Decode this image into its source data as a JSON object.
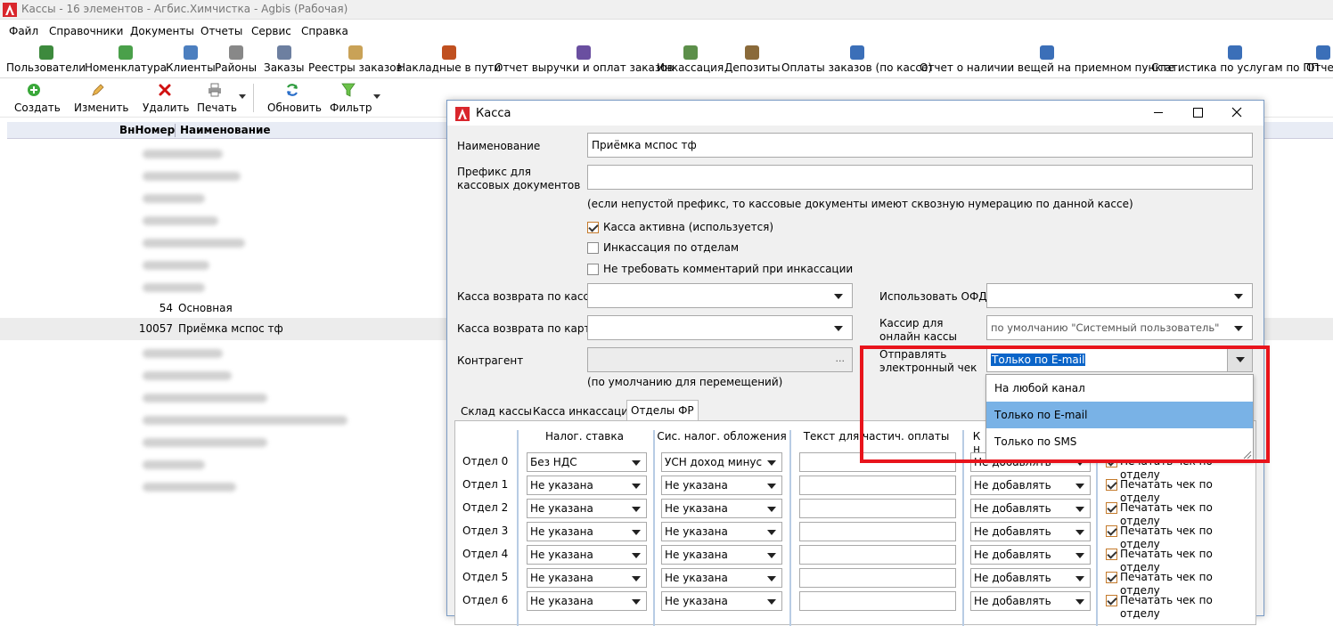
{
  "app": {
    "title": "Кассы - 16 элементов - Агбис.Химчистка - Agbis (Рабочая)"
  },
  "menu": [
    "Файл",
    "Справочники",
    "Документы",
    "Отчеты",
    "Сервис",
    "Справка"
  ],
  "ribbon": [
    "Пользователи",
    "Номенклатура",
    "Клиенты",
    "Районы",
    "Заказы",
    "Реестры заказов",
    "Накладные в пути",
    "Отчет выручки и оплат заказов",
    "Инкассация",
    "Депозиты",
    "Оплаты заказов (по кассе)",
    "Отчет о наличии вещей на приемном пункте",
    "Статистика по услугам по ПП",
    "Отчет"
  ],
  "toolbar": {
    "create": "Создать",
    "edit": "Изменить",
    "delete": "Удалить",
    "print": "Печать",
    "refresh": "Обновить",
    "filter": "Фильтр"
  },
  "grid": {
    "col_num": "ВнНомер",
    "col_name": "Наименование",
    "rows": [
      {
        "num": "54",
        "name": "Основная"
      },
      {
        "num": "10057",
        "name": "Приёмка мспос тф"
      }
    ]
  },
  "dialog": {
    "title": "Касса",
    "name_label": "Наименование",
    "name_value": "Приёмка мспос тф",
    "prefix_label": "Префикс для кассовых документов",
    "prefix_value": "",
    "prefix_hint": "(если непустой префикс, то кассовые документы имеют сквозную нумерацию по данной кассе)",
    "cb_active": "Касса активна (используется)",
    "cb_dept": "Инкассация по отделам",
    "cb_nocomment": "Не требовать комментарий при инкассации",
    "return_cash_label": "Касса возврата по кассе",
    "return_card_label": "Касса возврата по карте",
    "counterparty_label": "Контрагент",
    "counterparty_btn": "...",
    "counterparty_hint": "(по умолчанию для перемещений)",
    "ofd_label": "Использовать ОФД",
    "cashier_label": "Кассир для онлайн кассы",
    "cashier_value": "по умолчанию \"Системный пользователь\"",
    "send_label": "Отправлять электронный чек",
    "send_value": "Только по E-mail",
    "send_options": [
      "На любой канал",
      "Только по E-mail",
      "Только по SMS"
    ],
    "tabs": [
      "Склад кассы",
      "Касса инкассации",
      "Отделы ФР"
    ],
    "columns": {
      "tax": "Налог. ставка",
      "system": "Сис. налог. обложения",
      "text": "Текст для частич. оплаты",
      "k": "К н"
    },
    "departments": [
      {
        "label": "Отдел 0",
        "tax": "Без НДС",
        "system": "УСН доход минус расход",
        "add": "Не добавлять",
        "print": "Печатать чек по отделу"
      },
      {
        "label": "Отдел 1",
        "tax": "Не указана",
        "system": "Не указана",
        "add": "Не добавлять",
        "print": "Печатать чек по отделу"
      },
      {
        "label": "Отдел 2",
        "tax": "Не указана",
        "system": "Не указана",
        "add": "Не добавлять",
        "print": "Печатать чек по отделу"
      },
      {
        "label": "Отдел 3",
        "tax": "Не указана",
        "system": "Не указана",
        "add": "Не добавлять",
        "print": "Печатать чек по отделу"
      },
      {
        "label": "Отдел 4",
        "tax": "Не указана",
        "system": "Не указана",
        "add": "Не добавлять",
        "print": "Печатать чек по отделу"
      },
      {
        "label": "Отдел 5",
        "tax": "Не указана",
        "system": "Не указана",
        "add": "Не добавлять",
        "print": "Печатать чек по отделу"
      },
      {
        "label": "Отдел 6",
        "tax": "Не указана",
        "system": "Не указана",
        "add": "Не добавлять",
        "print": "Печатать чек по отделу"
      }
    ]
  },
  "colors": {
    "accent_red": "#e8141c",
    "selection_blue": "#79b2e6",
    "text_selection": "#0a64c8"
  },
  "icons": {
    "app_logo": "agbis-logo-icon",
    "create": "plus-circle-icon",
    "edit": "pencil-icon",
    "delete": "red-x-icon",
    "print": "printer-icon",
    "refresh": "refresh-icon",
    "filter": "funnel-icon"
  }
}
